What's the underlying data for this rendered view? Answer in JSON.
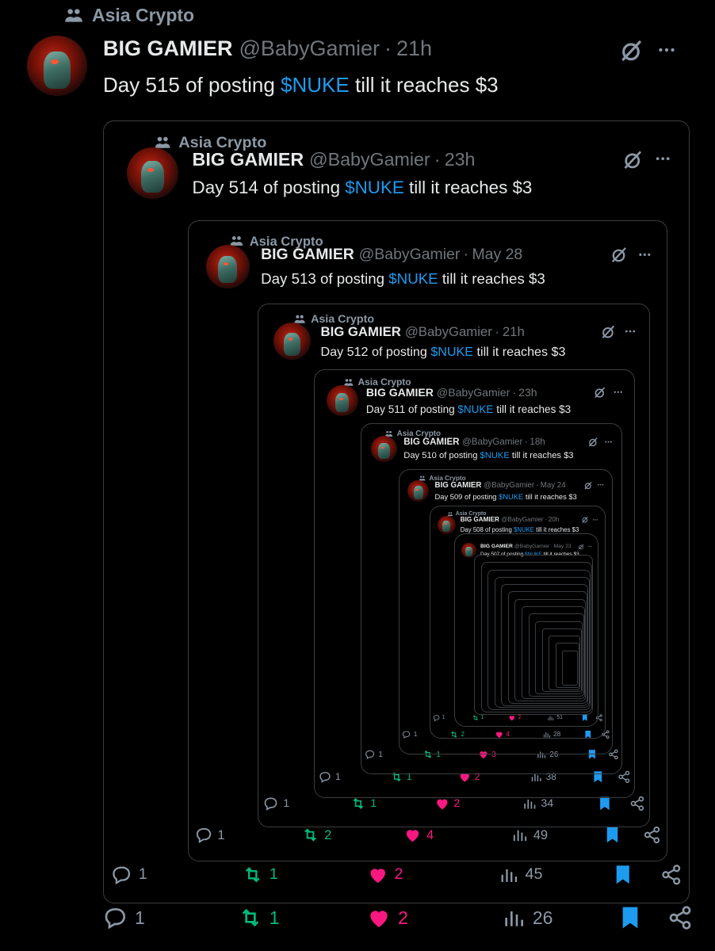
{
  "tweets": [
    {
      "community": "Asia Crypto",
      "name": "BIG GAMIER",
      "handle": "@BabyGamier",
      "dot": "·",
      "time": "21h",
      "text_prefix": "Day 515 of posting ",
      "ticker": "$NUKE",
      "text_suffix": " till it reaches $3",
      "replies": "1",
      "reposts": "1",
      "likes": "2",
      "views": "26"
    },
    {
      "community": "Asia Crypto",
      "name": "BIG GAMIER",
      "handle": "@BabyGamier",
      "dot": "·",
      "time": "23h",
      "text_prefix": "Day 514 of posting ",
      "ticker": "$NUKE",
      "text_suffix": " till it reaches $3",
      "replies": "1",
      "reposts": "1",
      "likes": "2",
      "views": "45"
    },
    {
      "community": "Asia Crypto",
      "name": "BIG GAMIER",
      "handle": "@BabyGamier",
      "dot": "·",
      "time": "May 28",
      "text_prefix": "Day 513 of posting ",
      "ticker": "$NUKE",
      "text_suffix": " till it reaches $3",
      "replies": "1",
      "reposts": "2",
      "likes": "4",
      "views": "49"
    },
    {
      "community": "Asia Crypto",
      "name": "BIG GAMIER",
      "handle": "@BabyGamier",
      "dot": "·",
      "time": "21h",
      "text_prefix": "Day 512 of posting ",
      "ticker": "$NUKE",
      "text_suffix": " till it reaches $3",
      "replies": "1",
      "reposts": "1",
      "likes": "2",
      "views": "34"
    },
    {
      "community": "Asia Crypto",
      "name": "BIG GAMIER",
      "handle": "@BabyGamier",
      "dot": "·",
      "time": "23h",
      "text_prefix": "Day 511 of posting ",
      "ticker": "$NUKE",
      "text_suffix": " till it reaches $3",
      "replies": "1",
      "reposts": "1",
      "likes": "2",
      "views": "38"
    },
    {
      "community": "Asia Crypto",
      "name": "BIG GAMIER",
      "handle": "@BabyGamier",
      "dot": "·",
      "time": "18h",
      "text_prefix": "Day 510 of posting ",
      "ticker": "$NUKE",
      "text_suffix": " till it reaches $3",
      "replies": "1",
      "reposts": "1",
      "likes": "3",
      "views": "26"
    },
    {
      "community": "Asia Crypto",
      "name": "BIG GAMIER",
      "handle": "@BabyGamier",
      "dot": "·",
      "time": "May 24",
      "text_prefix": "Day 509 of posting ",
      "ticker": "$NUKE",
      "text_suffix": " till it reaches $3",
      "replies": "1",
      "reposts": "2",
      "likes": "4",
      "views": "28"
    },
    {
      "community": "Asia Crypto",
      "name": "BIG GAMIER",
      "handle": "@BabyGamier",
      "dot": "·",
      "time": "20h",
      "text_prefix": "Day 508 of posting ",
      "ticker": "$NUKE",
      "text_suffix": " till it reaches $3",
      "replies": "1",
      "reposts": "1",
      "likes": "2",
      "views": "51"
    },
    {
      "community": "",
      "name": "BIG GAMIER",
      "handle": "@BabyGamier",
      "dot": "·",
      "time": "May 23",
      "text_prefix": "Day 507 of posting ",
      "ticker": "$NUKE",
      "text_suffix": " till it reaches $3",
      "replies": "",
      "reposts": "",
      "likes": "",
      "views": ""
    }
  ],
  "icons": {
    "community": "community-icon",
    "grok": "grok-icon",
    "more": "more-icon",
    "reply": "reply-icon",
    "repost": "repost-icon",
    "like": "heart-icon",
    "views": "views-icon",
    "bookmark": "bookmark-icon",
    "share": "share-icon"
  },
  "colors": {
    "background": "#000000",
    "text": "#e7e9ea",
    "muted": "#71767b",
    "border": "#3a3d41",
    "link": "#1d9bf0",
    "repost": "#00ba7c",
    "like": "#f91880",
    "bookmark": "#1d9bf0"
  }
}
